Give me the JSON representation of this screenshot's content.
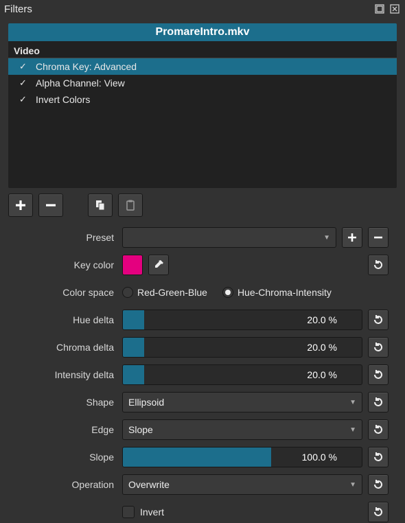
{
  "panel": {
    "title": "Filters"
  },
  "file": {
    "name": "PromareIntro.mkv"
  },
  "listSection": "Video",
  "filters": [
    {
      "label": "Chroma Key: Advanced",
      "checked": true,
      "selected": true
    },
    {
      "label": "Alpha Channel: View",
      "checked": true,
      "selected": false
    },
    {
      "label": "Invert Colors",
      "checked": true,
      "selected": false
    }
  ],
  "labels": {
    "preset": "Preset",
    "keyColor": "Key color",
    "colorSpace": "Color space",
    "hueDelta": "Hue delta",
    "chromaDelta": "Chroma delta",
    "intensityDelta": "Intensity delta",
    "shape": "Shape",
    "edge": "Edge",
    "slope": "Slope",
    "operation": "Operation",
    "invert": "Invert"
  },
  "colorSpace": {
    "rgb": "Red-Green-Blue",
    "hci": "Hue-Chroma-Intensity",
    "selected": "hci"
  },
  "values": {
    "keyColorHex": "#e4007f",
    "hueDelta": "20.0 %",
    "chromaDelta": "20.0 %",
    "intensityDelta": "20.0 %",
    "shape": "Ellipsoid",
    "edge": "Slope",
    "slope": "100.0 %",
    "operation": "Overwrite",
    "invert": false
  },
  "fills": {
    "hueDelta": 9,
    "chromaDelta": 9,
    "intensityDelta": 9,
    "slope": 62
  }
}
